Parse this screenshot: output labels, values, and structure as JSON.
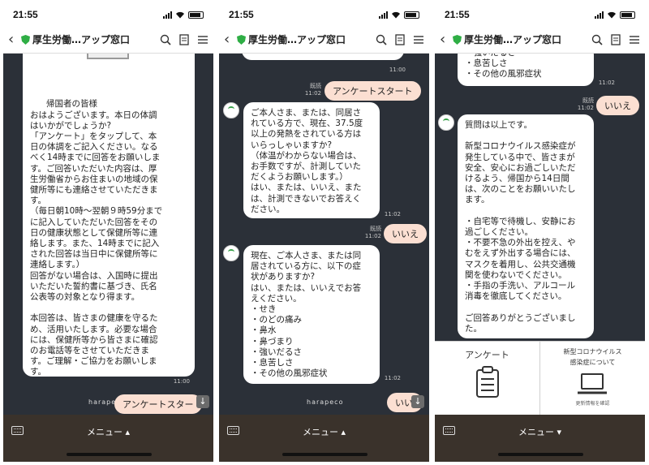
{
  "status": {
    "time": "21:55"
  },
  "header": {
    "title": "厚生労働…アップ窓口"
  },
  "menu": {
    "label": "メニュー"
  },
  "phone1": {
    "greeting": "帰国者の皆様\nおはようございます。本日の体調\nはいかがでしょうか?\n「アンケート」をタップして、本\n日の体調をご記入ください。なる\nべく14時までに回答をお願いしま\nす。ご回答いただいた内容は、厚\n生労働省からお住まいの地域の保\n健所等にも連絡させていただきま\nす。\n（毎日朝10時～翌朝９時59分まで\nに記入していただいた回答をその\n日の健康状態として保健所等に連\n絡します。また、14時までに記入\nされた回答は当日中に保健所等に\n連絡します。）\n回答がない場合は、入国時に提出\nいただいた誓約書に基づき、氏名\n公表等の対象となり得ます。\n\n本回答は、皆さまの健康を守るた\nめ、活用いたします。必要な場合\nには、保健所等から皆さまに確認\nのお電話等をさせていただきま\nす。ご理解・ご協力をお願いしま\nす。",
    "time": "11:00",
    "sent": "アンケートスター",
    "brand": "harapeco"
  },
  "phone2": {
    "time0": "11:00",
    "sent1": "アンケートスタート",
    "sent1_ts": "既読\n11:02",
    "q1": "ご本人さま、または、同居さ\nれている方で、現在、37.5度\n以上の発熱をされている方は\nいらっしゃいますか?\n（体温がわからない場合は、\nお手数ですが、計測していた\nだくようお願いします。）\nはい、または、いいえ、また\nは、計測できないでお答えく\nださい。",
    "q1_time": "11:02",
    "sent2": "いいえ",
    "sent2_ts": "既読\n11:02",
    "q2": "現在、ご本人さま、または同\n居されている方に、以下の症\n状がありますか?\nはい、または、いいえでお答\nえください。\n・せき\n・のどの痛み\n・鼻水\n・鼻づまり\n・強いだるさ\n・息苦しさ\n・その他の風邪症状",
    "q2_time": "11:02",
    "sent3": "いい",
    "brand": "harapeco"
  },
  "phone3": {
    "tail": "・強いだるさ\n・息苦しさ\n・その他の風邪症状",
    "tail_time": "11:02",
    "sent": "いいえ",
    "sent_ts": "既読\n11:02",
    "final": "質問は以上です。\n\n新型コロナウイルス感染症が\n発生している中で、皆さまが\n安全、安心にお過ごしいただ\nけるよう、帰国から14日間\nは、次のことをお願いいたし\nます。\n\n・自宅等で待機し、安静にお\n過ごしください。\n・不要不急の外出を控え、や\nむをえず外出する場合には、\nマスクを着用し、公共交通機\n関を使わないでください。\n・手指の手洗い、アルコール\n消毒を徹底してください。\n\nご回答ありがとうございまし\nた。",
    "rich": {
      "survey": "アンケート",
      "covid": "新型コロナウイルス\n感染症について",
      "covid_sub": "更新情報を確認"
    }
  }
}
